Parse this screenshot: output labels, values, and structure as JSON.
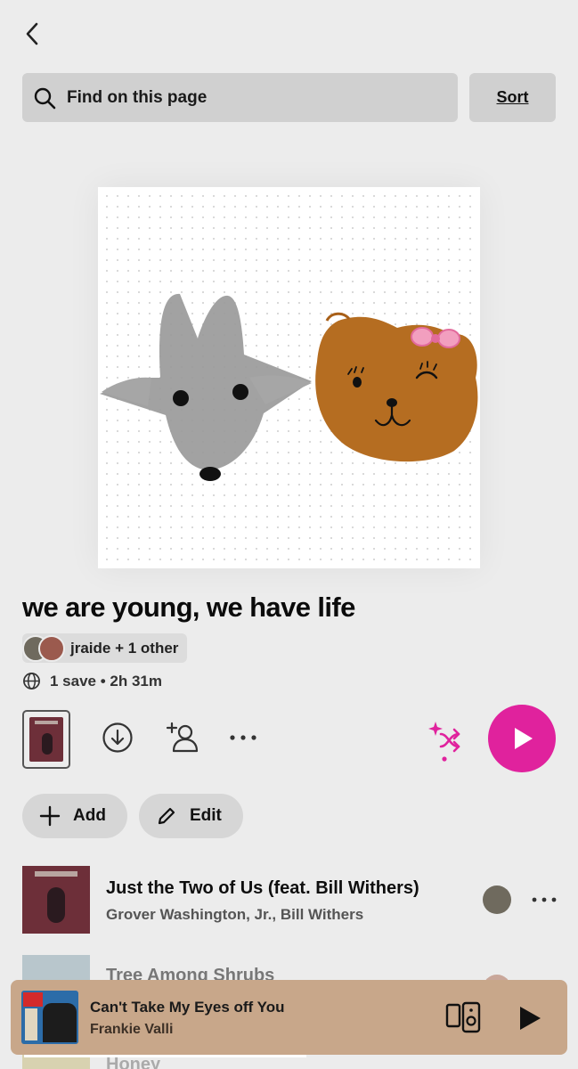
{
  "header": {
    "search_placeholder": "Find on this page",
    "sort_label": "Sort"
  },
  "playlist": {
    "title": "we are young, we have life",
    "owners": "jraide + 1 other",
    "meta": "1 save • 2h 31m"
  },
  "actions": {
    "add_label": "Add",
    "edit_label": "Edit"
  },
  "tracks": [
    {
      "title": "Just the Two of Us (feat. Bill Withers)",
      "artist": "Grover Washington, Jr., Bill Withers"
    },
    {
      "title": "Tree Among Shrubs",
      "artist": ""
    },
    {
      "title": "Honey",
      "artist": ""
    }
  ],
  "now_playing": {
    "title": "Can't Take My Eyes off You",
    "artist": "Frankie Valli",
    "progress": 0.52
  },
  "colors": {
    "accent": "#e0229d",
    "background": "#ececec",
    "now_playing_bg": "#c8a78a"
  }
}
